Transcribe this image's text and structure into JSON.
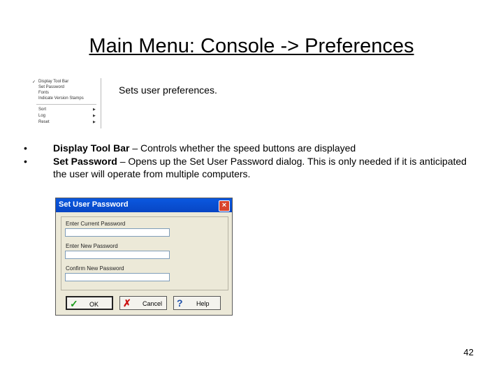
{
  "slide": {
    "title": "Main Menu:  Console -> Preferences",
    "description": "Sets user preferences.",
    "page_number": "42"
  },
  "menu": {
    "items": [
      {
        "label": "Display Tool Bar",
        "checked": true,
        "submenu": false
      },
      {
        "label": "Set Password",
        "checked": false,
        "submenu": false
      },
      {
        "label": "Fonts",
        "checked": false,
        "submenu": false
      },
      {
        "label": "Indicate Version Stamps",
        "checked": false,
        "submenu": false
      }
    ],
    "submenu_items": [
      {
        "label": "Sort",
        "submenu": true
      },
      {
        "label": "Log",
        "submenu": true
      },
      {
        "label": "Reset",
        "submenu": true
      }
    ]
  },
  "bullets": [
    {
      "term": "Display Tool Bar",
      "text": " – Controls whether the speed buttons are displayed"
    },
    {
      "term": "Set Password",
      "text": " – Opens up the Set User Password dialog.  This is only needed if it is anticipated the user will operate from multiple computers."
    }
  ],
  "dialog": {
    "title": "Set User Password",
    "close_glyph": "×",
    "fields": [
      {
        "label": "Enter Current Password",
        "value": ""
      },
      {
        "label": "Enter New Password",
        "value": ""
      },
      {
        "label": "Confirm New Password",
        "value": ""
      }
    ],
    "buttons": {
      "ok": "OK",
      "cancel": "Cancel",
      "help": "Help"
    }
  },
  "colors": {
    "titlebar": "#0a58e0",
    "dialog_bg": "#ece9d8",
    "ok_check": "#1a9a1a",
    "cancel_x": "#cc1111",
    "help_q": "#1d4fa8"
  }
}
